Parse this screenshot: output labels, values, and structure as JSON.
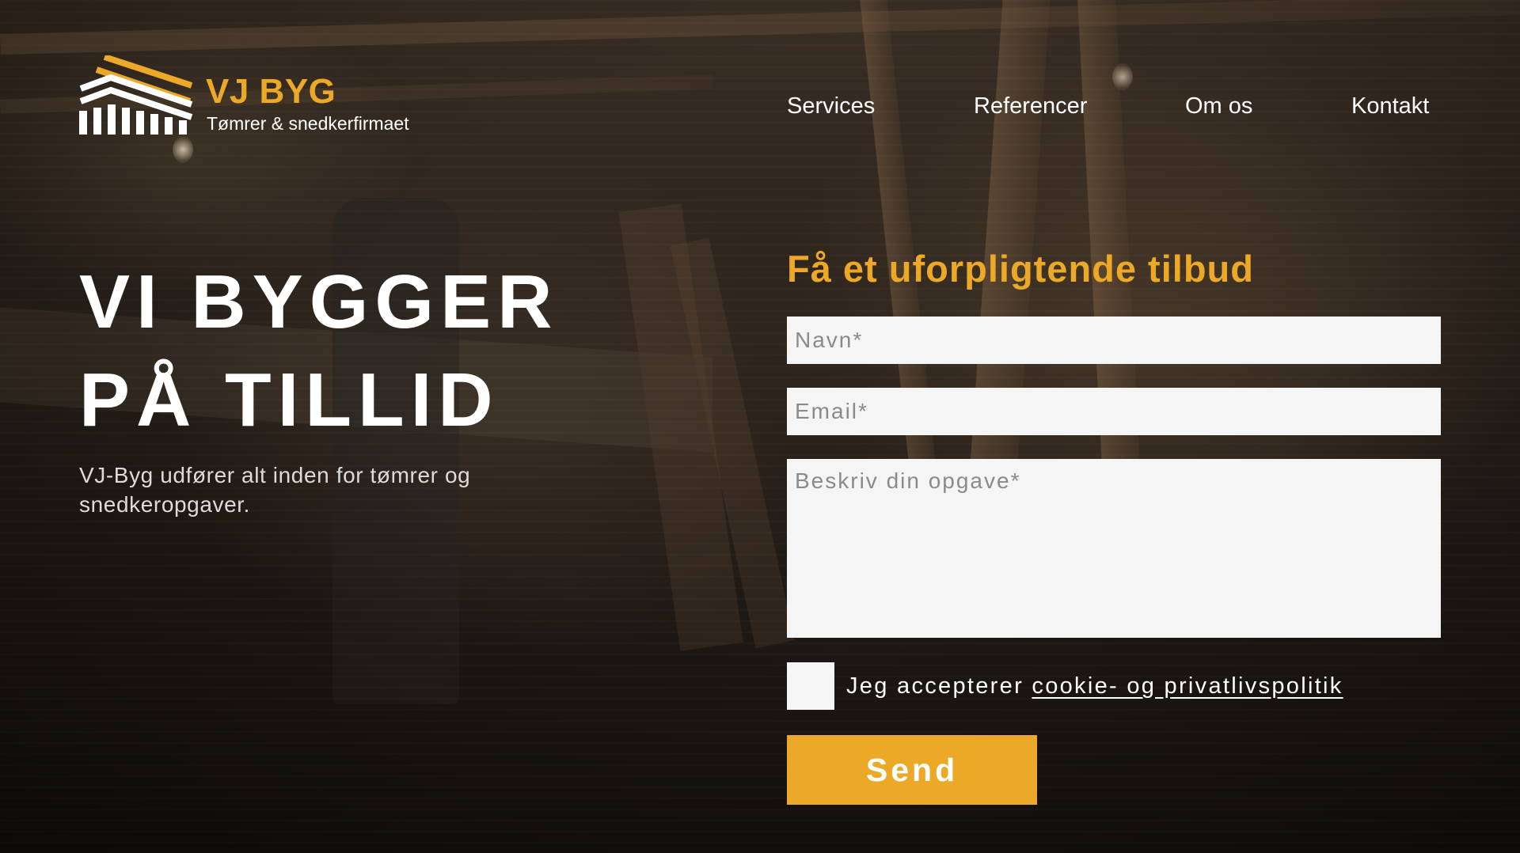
{
  "brand": {
    "name": "VJ BYG",
    "tagline": "Tømrer & snedkerfirmaet",
    "logo_icon": "roof-stripes-logo-icon"
  },
  "nav": {
    "items": [
      {
        "label": "Services"
      },
      {
        "label": "Referencer"
      },
      {
        "label": "Om os"
      },
      {
        "label": "Kontakt"
      }
    ]
  },
  "hero": {
    "title_line1": "VI BYGGER",
    "title_line2": "PÅ TILLID",
    "subtitle": "VJ-Byg udfører alt inden for tømrer og snedkeropgaver."
  },
  "form": {
    "title": "Få et uforpligtende tilbud",
    "name_placeholder": "Navn*",
    "name_value": "",
    "email_placeholder": "Email*",
    "email_value": "",
    "message_placeholder": "Beskriv din opgave*",
    "message_value": "",
    "consent_prefix": "Jeg accepterer",
    "consent_link": "cookie- og privatlivspolitik",
    "consent_checked": false,
    "submit_label": "Send"
  },
  "colors": {
    "accent": "#eca827",
    "field_background": "#f5f5f5",
    "text_light": "#ffffff"
  }
}
